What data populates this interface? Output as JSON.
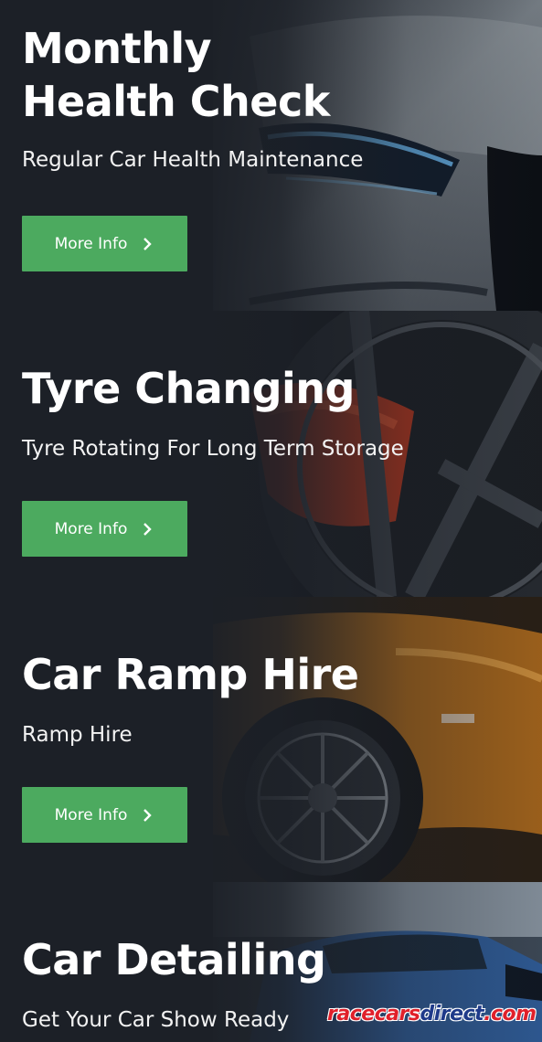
{
  "services": [
    {
      "title_line1": "Monthly",
      "title_line2": "Health Check",
      "subtitle": "Regular Car Health Maintenance",
      "button_label": "More Info",
      "button_icon": "chevron-right-icon"
    },
    {
      "title_line1": "Tyre Changing",
      "subtitle": "Tyre Rotating For Long Term Storage",
      "button_label": "More Info",
      "button_icon": "chevron-right-icon"
    },
    {
      "title_line1": "Car Ramp Hire",
      "subtitle": "Ramp Hire",
      "button_label": "More Info",
      "button_icon": "chevron-right-icon"
    },
    {
      "title_line1": "Car Detailing",
      "subtitle": "Get Your Car Show Ready"
    }
  ],
  "watermark": {
    "part1": "racecars",
    "part2": "direct",
    "part3": ".com"
  },
  "colors": {
    "background": "#1c2027",
    "button": "#4caa5f",
    "text": "#ffffff"
  }
}
